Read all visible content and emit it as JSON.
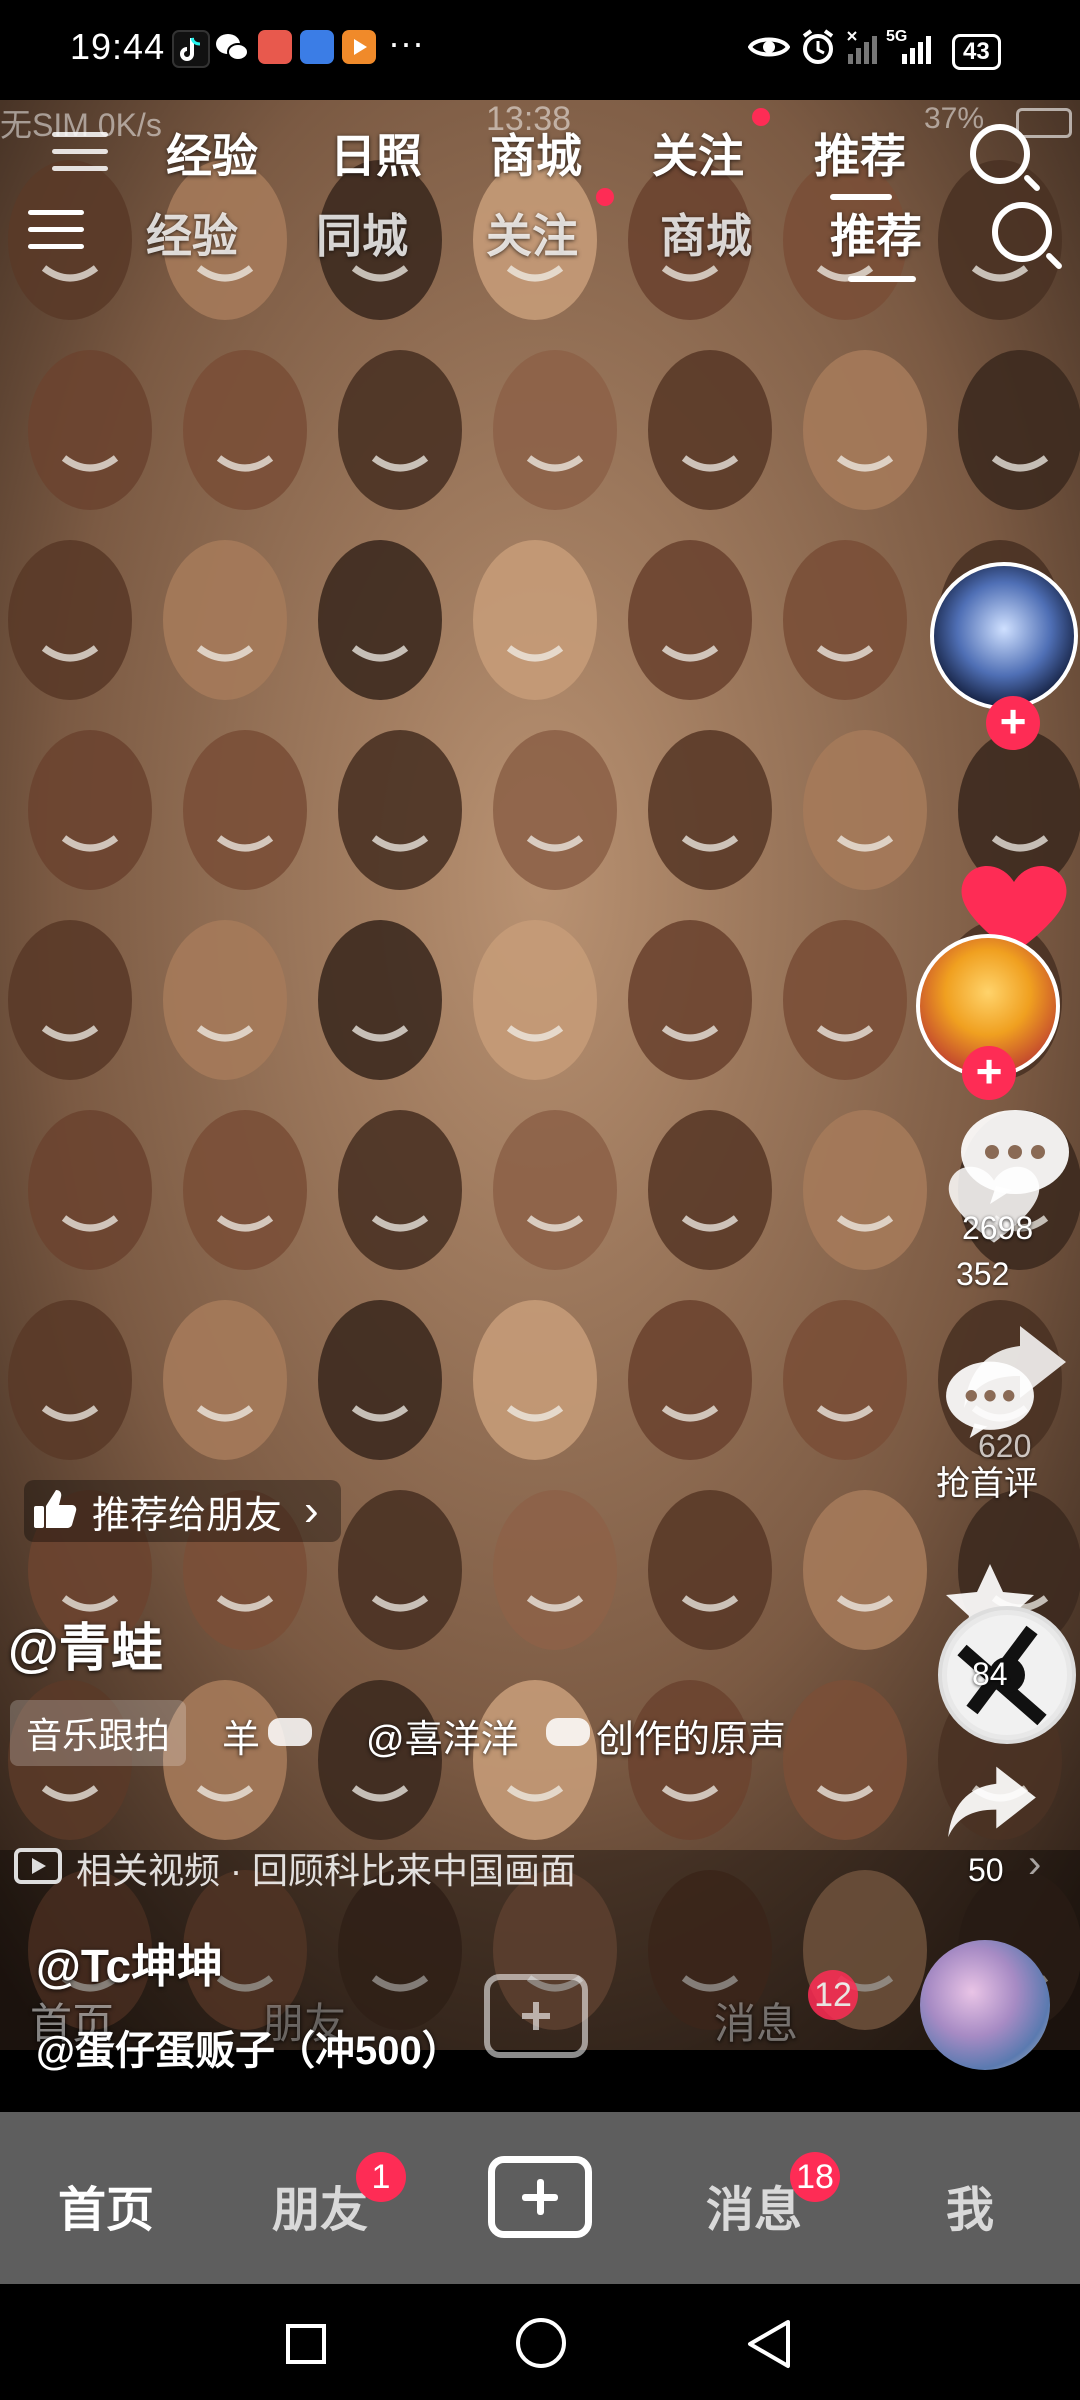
{
  "status_bar": {
    "time": "19:44",
    "more": "···",
    "network": "5G",
    "battery": "43"
  },
  "ghost_status": {
    "sim_text": "无SIM 0K/s",
    "time": "13:38",
    "battery": "37%"
  },
  "top_tabs_ghost": [
    "经验",
    "日照",
    "商城",
    "关注",
    "推荐"
  ],
  "top_tabs": {
    "items": [
      "经验",
      "同城",
      "关注",
      "商城",
      "推荐"
    ],
    "active": "推荐"
  },
  "right_rail": {
    "likes_count": "2698",
    "likes_count_sub": "352",
    "comments_label": "抢首评",
    "comments_count": "620",
    "favorites_count": "84",
    "share_count": "50"
  },
  "recommend": {
    "label": "推荐给朋友",
    "chevron": "›"
  },
  "author": {
    "handle": "@青蛙",
    "music_prefix": "音乐跟拍",
    "music_text": "羊",
    "music_credit": "@喜洋洋",
    "music_suffix": "创作的原声"
  },
  "related": {
    "text": "相关视频 · 回顾科比来中国画面"
  },
  "ghost_captions": {
    "user1": "@Tc坤坤",
    "user2": "@蛋仔蛋贩子（冲500）",
    "nav_home": "首页",
    "nav_friends": "朋友",
    "nav_messages": "消息",
    "nav_messages_badge": "12"
  },
  "bottom_nav": {
    "home": "首页",
    "friends": "朋友",
    "friends_badge": "1",
    "messages": "消息",
    "messages_badge": "18",
    "me": "我"
  },
  "colors": {
    "accent": "#fe2c55",
    "nav_bg": "#5e5e5e"
  }
}
